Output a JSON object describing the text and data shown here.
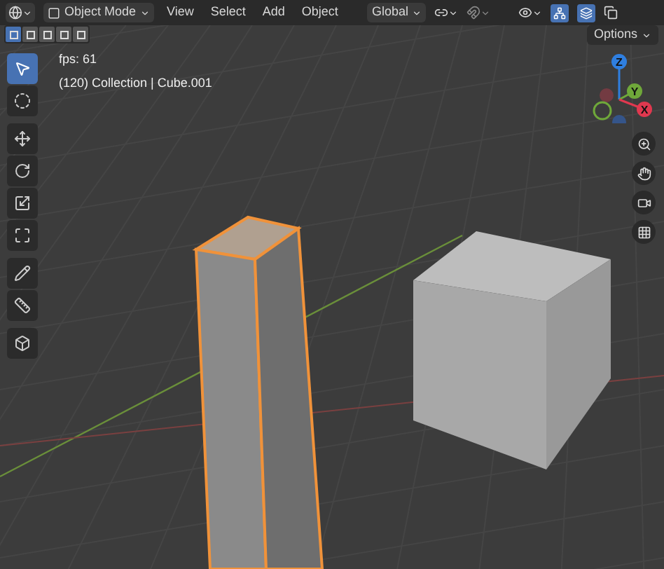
{
  "header": {
    "mode": "Object Mode",
    "menus": [
      "View",
      "Select",
      "Add",
      "Object"
    ],
    "orientation": "Global",
    "toggles": [
      {
        "kind": "gizmos",
        "on": true
      },
      {
        "kind": "overlays",
        "on": true
      }
    ]
  },
  "select_modes": [
    {
      "selected": true
    },
    {
      "selected": false
    },
    {
      "selected": false
    },
    {
      "selected": false
    },
    {
      "selected": false
    }
  ],
  "options": "Options",
  "overlay_text": [
    "fps: 61",
    "(120) Collection | Cube.001"
  ],
  "tools": [
    {
      "kind": "select",
      "selected": true
    },
    {
      "kind": "cursor",
      "selected": false
    },
    {
      "kind": "move",
      "selected": false
    },
    {
      "kind": "rotate",
      "selected": false
    },
    {
      "kind": "scale",
      "selected": false
    },
    {
      "kind": "transform",
      "selected": false
    },
    {
      "kind": "annotate",
      "selected": false
    },
    {
      "kind": "measure",
      "selected": false
    },
    {
      "kind": "add-cube",
      "selected": false
    }
  ],
  "gizmo": {
    "axes": [
      {
        "label": "Z",
        "color": "#2f7fe0"
      },
      {
        "label": "Y",
        "color": "#6fa83a"
      },
      {
        "label": "X",
        "color": "#e0384f"
      }
    ]
  },
  "nav_buttons": [
    {
      "kind": "zoom"
    },
    {
      "kind": "pan"
    },
    {
      "kind": "camera"
    },
    {
      "kind": "grid"
    }
  ]
}
